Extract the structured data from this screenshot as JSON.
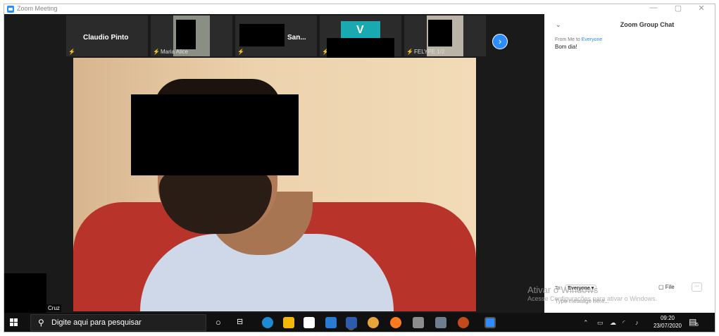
{
  "window": {
    "title": "Zoom Meeting",
    "minimize": "—",
    "restore": "▢",
    "close": "✕"
  },
  "participants": [
    {
      "name": "Claudio Pinto",
      "label": ""
    },
    {
      "name": "",
      "label": "Maria Alice"
    },
    {
      "name": "San...",
      "label": ""
    },
    {
      "name": "V",
      "label": ""
    },
    {
      "name": "",
      "label": "FELYPE 1/2"
    }
  ],
  "self_view": {
    "label": "Cruz"
  },
  "next_page_icon": "chevron-right-icon",
  "chat": {
    "title": "Zoom Group Chat",
    "from_prefix": "From Me to",
    "from_target": "Everyone",
    "message": "Bom dia!",
    "to_label": "To:",
    "to_value": "Everyone ▾",
    "file_label": "File",
    "more_label": "···",
    "input_placeholder": "Type message here..."
  },
  "activation": {
    "line1": "Ativar o Windows",
    "line2": "Acesse Configurações para ativar o Windows."
  },
  "taskbar": {
    "search_placeholder": "Digite aqui para pesquisar",
    "time": "09:20",
    "date": "23/07/2020",
    "notification_count": "5",
    "mail_badge": "8"
  },
  "colors": {
    "zoom_blue": "#2d8cff",
    "mute_red": "#e02828",
    "dark_bg": "#1a1a1a"
  }
}
